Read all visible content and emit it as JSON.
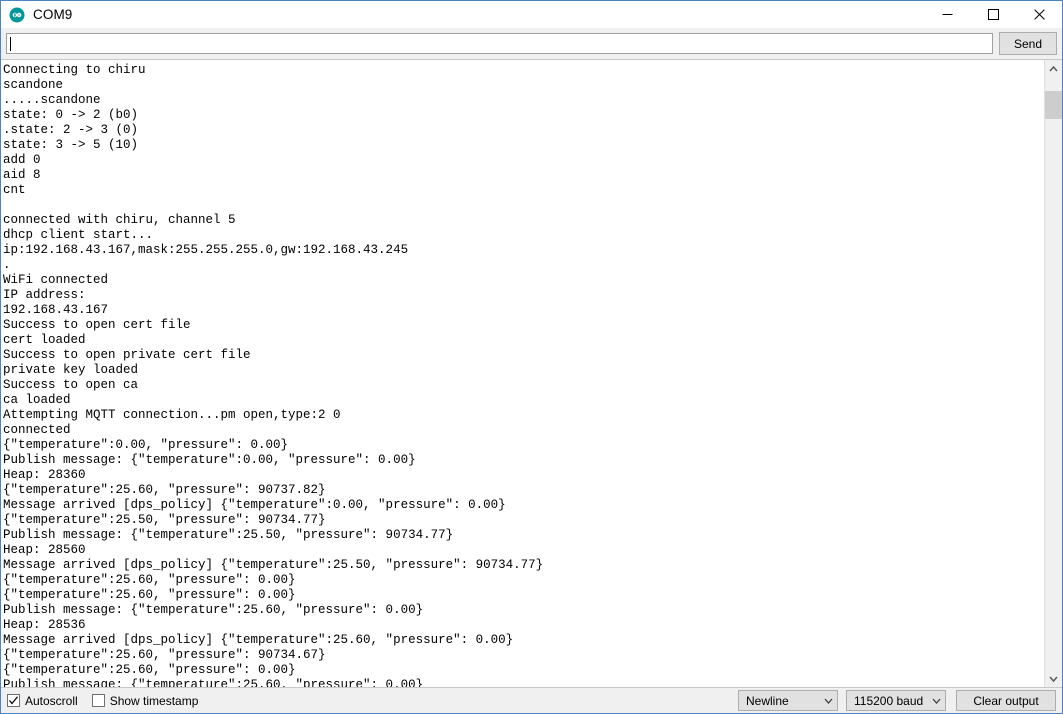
{
  "window": {
    "title": "COM9",
    "app_icon": "arduino-logo-icon",
    "accent_color": "#00979c",
    "minimize_label": "Minimize",
    "maximize_label": "Maximize",
    "close_label": "Close"
  },
  "send_bar": {
    "input_value": "",
    "input_placeholder": "",
    "send_label": "Send"
  },
  "console": {
    "lines": [
      "Connecting to chiru",
      "scandone",
      ".....scandone",
      "state: 0 -> 2 (b0)",
      ".state: 2 -> 3 (0)",
      "state: 3 -> 5 (10)",
      "add 0",
      "aid 8",
      "cnt",
      "",
      "connected with chiru, channel 5",
      "dhcp client start...",
      "ip:192.168.43.167,mask:255.255.255.0,gw:192.168.43.245",
      ".",
      "WiFi connected",
      "IP address: ",
      "192.168.43.167",
      "Success to open cert file",
      "cert loaded",
      "Success to open private cert file",
      "private key loaded",
      "Success to open ca",
      "ca loaded",
      "Attempting MQTT connection...pm open,type:2 0",
      "connected",
      "{\"temperature\":0.00, \"pressure\": 0.00}",
      "Publish message: {\"temperature\":0.00, \"pressure\": 0.00}",
      "Heap: 28360",
      "{\"temperature\":25.60, \"pressure\": 90737.82}",
      "Message arrived [dps_policy] {\"temperature\":0.00, \"pressure\": 0.00}",
      "{\"temperature\":25.50, \"pressure\": 90734.77}",
      "Publish message: {\"temperature\":25.50, \"pressure\": 90734.77}",
      "Heap: 28560",
      "Message arrived [dps_policy] {\"temperature\":25.50, \"pressure\": 90734.77}",
      "{\"temperature\":25.60, \"pressure\": 0.00}",
      "{\"temperature\":25.60, \"pressure\": 0.00}",
      "Publish message: {\"temperature\":25.60, \"pressure\": 0.00}",
      "Heap: 28536",
      "Message arrived [dps_policy] {\"temperature\":25.60, \"pressure\": 0.00}",
      "{\"temperature\":25.60, \"pressure\": 90734.67}",
      "{\"temperature\":25.60, \"pressure\": 0.00}",
      "Publish message: {\"temperature\":25.60, \"pressure\": 0.00}"
    ]
  },
  "status_bar": {
    "autoscroll_label": "Autoscroll",
    "autoscroll_checked": true,
    "show_timestamp_label": "Show timestamp",
    "show_timestamp_checked": false,
    "line_ending_value": "Newline",
    "baud_value": "115200 baud",
    "clear_output_label": "Clear output"
  }
}
